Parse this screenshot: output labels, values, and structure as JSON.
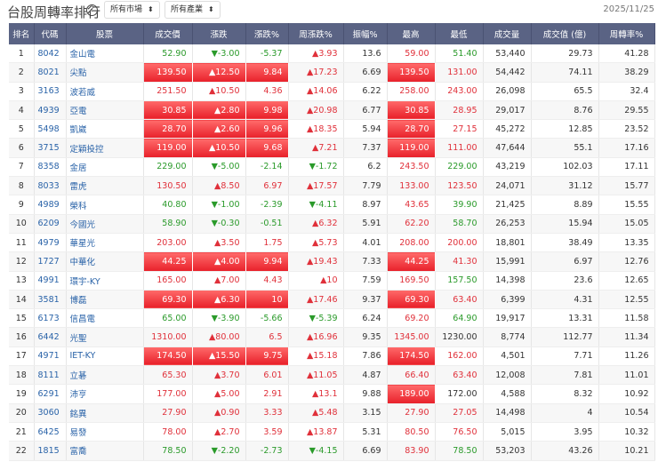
{
  "header": {
    "title": "台股周轉率排行",
    "help_icon": "?",
    "market_select": "所有市場",
    "industry_select": "所有產業",
    "date": "2025/11/25"
  },
  "columns": [
    "排名",
    "代碼",
    "股票",
    "成交價",
    "漲跌",
    "漲跌%",
    "周漲跌%",
    "振幅%",
    "最高",
    "最低",
    "成交量",
    "成交值 (億)",
    "周轉率%"
  ],
  "colors": {
    "up": "#e0303a",
    "down": "#2a9a2a",
    "header_bg": "#5a6384"
  },
  "rows": [
    {
      "rank": "1",
      "code": "8042",
      "name": "金山電",
      "price": "52.90",
      "chg": "▼-3.00",
      "pct": "-5.37",
      "wk": "▲3.93",
      "amp": "13.6",
      "high": "59.00",
      "low": "51.40",
      "vol": "53,440",
      "val": "29.73",
      "turn": "41.28",
      "dir": "g",
      "wdir": "r",
      "lowc": "g",
      "limit": false,
      "highhl": false
    },
    {
      "rank": "2",
      "code": "8021",
      "name": "尖點",
      "price": "139.50",
      "chg": "▲12.50",
      "pct": "9.84",
      "wk": "▲17.23",
      "amp": "6.69",
      "high": "139.50",
      "low": "131.00",
      "vol": "54,442",
      "val": "74.11",
      "turn": "38.29",
      "dir": "r",
      "wdir": "r",
      "lowc": "r",
      "limit": true,
      "highhl": true
    },
    {
      "rank": "3",
      "code": "3163",
      "name": "波若威",
      "price": "251.50",
      "chg": "▲10.50",
      "pct": "4.36",
      "wk": "▲14.06",
      "amp": "6.22",
      "high": "258.00",
      "low": "243.00",
      "vol": "26,098",
      "val": "65.5",
      "turn": "32.4",
      "dir": "r",
      "wdir": "r",
      "lowc": "r",
      "limit": false,
      "highhl": false
    },
    {
      "rank": "4",
      "code": "4939",
      "name": "亞電",
      "price": "30.85",
      "chg": "▲2.80",
      "pct": "9.98",
      "wk": "▲20.98",
      "amp": "6.77",
      "high": "30.85",
      "low": "28.95",
      "vol": "29,017",
      "val": "8.76",
      "turn": "29.55",
      "dir": "r",
      "wdir": "r",
      "lowc": "r",
      "limit": true,
      "highhl": true
    },
    {
      "rank": "5",
      "code": "5498",
      "name": "凱崴",
      "price": "28.70",
      "chg": "▲2.60",
      "pct": "9.96",
      "wk": "▲18.35",
      "amp": "5.94",
      "high": "28.70",
      "low": "27.15",
      "vol": "45,272",
      "val": "12.85",
      "turn": "23.52",
      "dir": "r",
      "wdir": "r",
      "lowc": "r",
      "limit": true,
      "highhl": true
    },
    {
      "rank": "6",
      "code": "3715",
      "name": "定穎投控",
      "price": "119.00",
      "chg": "▲10.50",
      "pct": "9.68",
      "wk": "▲7.21",
      "amp": "7.37",
      "high": "119.00",
      "low": "111.00",
      "vol": "47,644",
      "val": "55.1",
      "turn": "17.16",
      "dir": "r",
      "wdir": "r",
      "lowc": "r",
      "limit": true,
      "highhl": true
    },
    {
      "rank": "7",
      "code": "8358",
      "name": "金居",
      "price": "229.00",
      "chg": "▼-5.00",
      "pct": "-2.14",
      "wk": "▼-1.72",
      "amp": "6.2",
      "high": "243.50",
      "low": "229.00",
      "vol": "43,219",
      "val": "102.03",
      "turn": "17.11",
      "dir": "g",
      "wdir": "g",
      "lowc": "g",
      "limit": false,
      "highhl": false
    },
    {
      "rank": "8",
      "code": "8033",
      "name": "雷虎",
      "price": "130.50",
      "chg": "▲8.50",
      "pct": "6.97",
      "wk": "▲17.57",
      "amp": "7.79",
      "high": "133.00",
      "low": "123.50",
      "vol": "24,071",
      "val": "31.12",
      "turn": "15.77",
      "dir": "r",
      "wdir": "r",
      "lowc": "r",
      "limit": false,
      "highhl": false
    },
    {
      "rank": "9",
      "code": "4989",
      "name": "榮科",
      "price": "40.80",
      "chg": "▼-1.00",
      "pct": "-2.39",
      "wk": "▼-4.11",
      "amp": "8.97",
      "high": "43.65",
      "low": "39.90",
      "vol": "21,425",
      "val": "8.89",
      "turn": "15.55",
      "dir": "g",
      "wdir": "g",
      "lowc": "g",
      "limit": false,
      "highhl": false
    },
    {
      "rank": "10",
      "code": "6209",
      "name": "今國光",
      "price": "58.90",
      "chg": "▼-0.30",
      "pct": "-0.51",
      "wk": "▲6.32",
      "amp": "5.91",
      "high": "62.20",
      "low": "58.70",
      "vol": "26,253",
      "val": "15.94",
      "turn": "15.05",
      "dir": "g",
      "wdir": "r",
      "lowc": "g",
      "limit": false,
      "highhl": false
    },
    {
      "rank": "11",
      "code": "4979",
      "name": "華星光",
      "price": "203.00",
      "chg": "▲3.50",
      "pct": "1.75",
      "wk": "▲5.73",
      "amp": "4.01",
      "high": "208.00",
      "low": "200.00",
      "vol": "18,801",
      "val": "38.49",
      "turn": "13.35",
      "dir": "r",
      "wdir": "r",
      "lowc": "r",
      "limit": false,
      "highhl": false
    },
    {
      "rank": "12",
      "code": "1727",
      "name": "中華化",
      "price": "44.25",
      "chg": "▲4.00",
      "pct": "9.94",
      "wk": "▲19.43",
      "amp": "7.33",
      "high": "44.25",
      "low": "41.30",
      "vol": "15,991",
      "val": "6.97",
      "turn": "12.76",
      "dir": "r",
      "wdir": "r",
      "lowc": "r",
      "limit": true,
      "highhl": true
    },
    {
      "rank": "13",
      "code": "4991",
      "name": "環宇-KY",
      "price": "165.00",
      "chg": "▲7.00",
      "pct": "4.43",
      "wk": "▲10",
      "amp": "7.59",
      "high": "169.50",
      "low": "157.50",
      "vol": "14,398",
      "val": "23.6",
      "turn": "12.65",
      "dir": "r",
      "wdir": "r",
      "lowc": "g",
      "limit": false,
      "highhl": false
    },
    {
      "rank": "14",
      "code": "3581",
      "name": "博磊",
      "price": "69.30",
      "chg": "▲6.30",
      "pct": "10",
      "wk": "▲17.46",
      "amp": "9.37",
      "high": "69.30",
      "low": "63.40",
      "vol": "6,399",
      "val": "4.31",
      "turn": "12.55",
      "dir": "r",
      "wdir": "r",
      "lowc": "r",
      "limit": true,
      "highhl": true
    },
    {
      "rank": "15",
      "code": "6173",
      "name": "信昌電",
      "price": "65.00",
      "chg": "▼-3.90",
      "pct": "-5.66",
      "wk": "▼-5.39",
      "amp": "6.24",
      "high": "69.20",
      "low": "64.90",
      "vol": "19,917",
      "val": "13.31",
      "turn": "11.58",
      "dir": "g",
      "wdir": "g",
      "lowc": "g",
      "limit": false,
      "highhl": false
    },
    {
      "rank": "16",
      "code": "6442",
      "name": "光聖",
      "price": "1310.00",
      "chg": "▲80.00",
      "pct": "6.5",
      "wk": "▲16.96",
      "amp": "9.35",
      "high": "1345.00",
      "low": "1230.00",
      "vol": "8,774",
      "val": "112.77",
      "turn": "11.34",
      "dir": "r",
      "wdir": "r",
      "lowc": "k",
      "limit": false,
      "highhl": false
    },
    {
      "rank": "17",
      "code": "4971",
      "name": "IET-KY",
      "price": "174.50",
      "chg": "▲15.50",
      "pct": "9.75",
      "wk": "▲15.18",
      "amp": "7.86",
      "high": "174.50",
      "low": "162.00",
      "vol": "4,501",
      "val": "7.71",
      "turn": "11.26",
      "dir": "r",
      "wdir": "r",
      "lowc": "r",
      "limit": true,
      "highhl": true
    },
    {
      "rank": "18",
      "code": "8111",
      "name": "立碁",
      "price": "65.30",
      "chg": "▲3.70",
      "pct": "6.01",
      "wk": "▲11.05",
      "amp": "4.87",
      "high": "66.40",
      "low": "63.40",
      "vol": "12,008",
      "val": "7.81",
      "turn": "11.01",
      "dir": "r",
      "wdir": "r",
      "lowc": "r",
      "limit": false,
      "highhl": false
    },
    {
      "rank": "19",
      "code": "6291",
      "name": "沛亨",
      "price": "177.00",
      "chg": "▲5.00",
      "pct": "2.91",
      "wk": "▲13.1",
      "amp": "9.88",
      "high": "189.00",
      "low": "172.00",
      "vol": "4,588",
      "val": "8.32",
      "turn": "10.92",
      "dir": "r",
      "wdir": "r",
      "lowc": "k",
      "limit": false,
      "highhl": true
    },
    {
      "rank": "20",
      "code": "3060",
      "name": "銘異",
      "price": "27.90",
      "chg": "▲0.90",
      "pct": "3.33",
      "wk": "▲5.48",
      "amp": "3.15",
      "high": "27.90",
      "low": "27.05",
      "vol": "14,498",
      "val": "4",
      "turn": "10.54",
      "dir": "r",
      "wdir": "r",
      "lowc": "r",
      "limit": false,
      "highhl": false
    },
    {
      "rank": "21",
      "code": "6425",
      "name": "易發",
      "price": "78.00",
      "chg": "▲2.70",
      "pct": "3.59",
      "wk": "▲13.87",
      "amp": "5.31",
      "high": "80.50",
      "low": "76.50",
      "vol": "5,015",
      "val": "3.95",
      "turn": "10.32",
      "dir": "r",
      "wdir": "r",
      "lowc": "r",
      "limit": false,
      "highhl": false
    },
    {
      "rank": "22",
      "code": "1815",
      "name": "富喬",
      "price": "78.50",
      "chg": "▼-2.20",
      "pct": "-2.73",
      "wk": "▼-4.15",
      "amp": "6.69",
      "high": "83.90",
      "low": "78.50",
      "vol": "53,203",
      "val": "43.26",
      "turn": "10.21",
      "dir": "g",
      "wdir": "g",
      "lowc": "g",
      "limit": false,
      "highhl": false
    }
  ]
}
